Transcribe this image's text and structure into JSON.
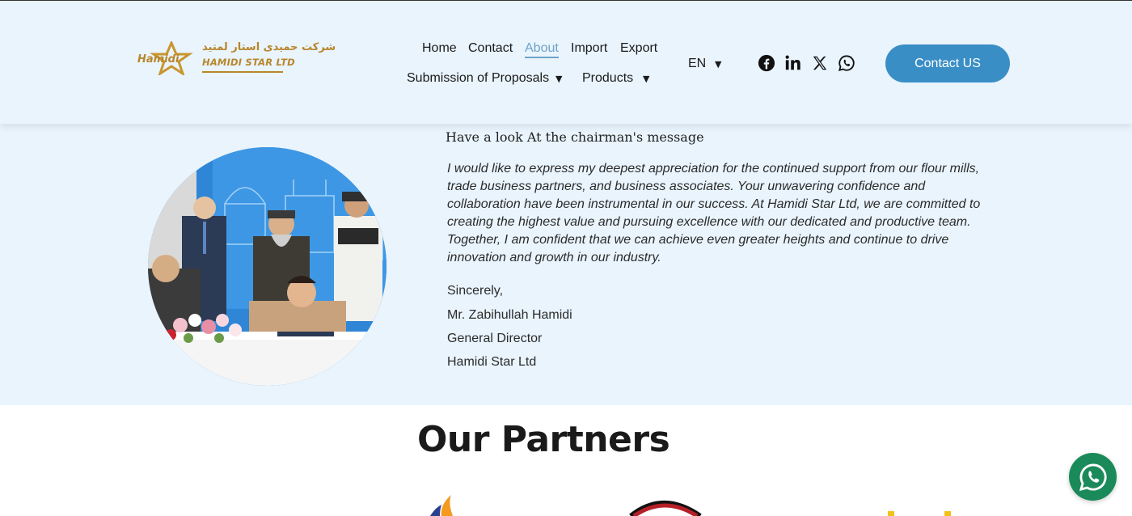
{
  "header": {
    "logo": {
      "arabic_text": "شرکت حمیدی استار لمتید",
      "english_text": "HAMIDI STAR LTD",
      "star_text": "Hamidi"
    },
    "nav": {
      "home": "Home",
      "contact": "Contact",
      "about": "About",
      "import": "Import",
      "export": "Export",
      "proposals": "Submission of Proposals",
      "products": "Products"
    },
    "language": "EN",
    "social_icons": [
      "facebook-icon",
      "linkedin-icon",
      "x-icon",
      "whatsapp-icon"
    ],
    "contact_button": "Contact US"
  },
  "chairman": {
    "heading": "Have a look At the chairman's message",
    "message": "I would like to express my deepest appreciation for the continued support from our flour mills, trade business partners, and business associates. Your unwavering confidence and collaboration have been instrumental in our success. At Hamidi Star Ltd, we are committed to creating the highest value and pursuing excellence with our dedicated and productive team. Together, I am confident that we can achieve even greater heights and continue to drive innovation and growth in our industry.",
    "closing": "Sincerely,",
    "name": "Mr. Zabihullah Hamidi",
    "title": "General Director",
    "company": "Hamidi Star Ltd"
  },
  "partners": {
    "title": "Our Partners"
  },
  "colors": {
    "header_bg": "#e9f4fd",
    "accent": "#3a8ec6",
    "active_link": "#6fa3c8",
    "logo_gold": "#b8862b",
    "whatsapp_green": "#1b8a5a"
  }
}
